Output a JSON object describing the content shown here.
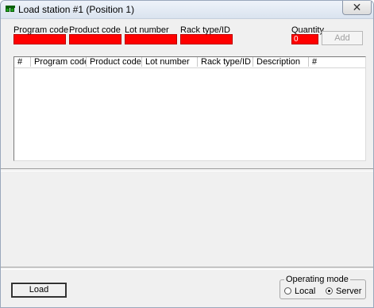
{
  "window": {
    "title": "Load station #1 (Position 1)",
    "close_glyph": "✕"
  },
  "fields": {
    "program_code_label": "Program code",
    "product_code_label": "Product code",
    "lot_number_label": "Lot number",
    "rack_type_label": "Rack type/ID",
    "program_code_value": "",
    "product_code_value": "",
    "lot_number_value": "",
    "rack_type_value": "",
    "quantity_label": "Quantity",
    "quantity_value": "0",
    "field_color": "#ff0000"
  },
  "buttons": {
    "add_label": "Add",
    "load_label": "Load"
  },
  "table": {
    "columns": [
      "#",
      "Program code",
      "Product code",
      "Lot number",
      "Rack type/ID",
      "Description",
      "#"
    ],
    "rows": []
  },
  "operating_mode": {
    "title": "Operating mode",
    "options": [
      "Local",
      "Server"
    ],
    "selected": "Server"
  }
}
